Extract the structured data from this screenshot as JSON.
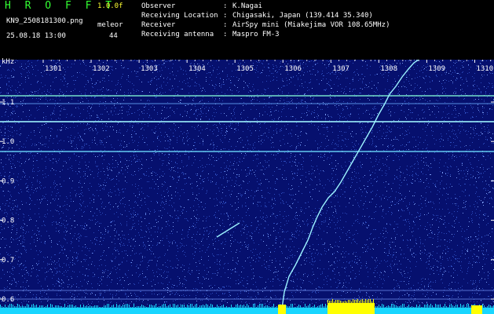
{
  "header": {
    "title": "H R O F F T",
    "version": "1.0.0f",
    "filename": "KN9_2508181300.png",
    "observer_name": "meleor",
    "datetime": "25.08.18 13:00",
    "count": "44",
    "fields": [
      {
        "label": "Observer",
        "value": "K.Nagai"
      },
      {
        "label": "Receiving Location",
        "value": "Chigasaki, Japan (139.414 35.340)"
      },
      {
        "label": "Receiver",
        "value": "AirSpy mini (Miakejima VOR 108.65MHz)"
      },
      {
        "label": "Receiving antenna",
        "value": "Maspro FM-3"
      }
    ]
  },
  "spectrogram": {
    "y_unit": "kHz",
    "x_ticks": [
      "1301",
      "1302",
      "1303",
      "1304",
      "1305",
      "1306",
      "1307",
      "1308",
      "1309",
      "1310"
    ],
    "y_ticks": [
      "1.1",
      "1.0",
      "0.9",
      "0.8",
      "0.7",
      "0.6"
    ],
    "background_color": "#06106e",
    "noise_color": "#3a5fd8",
    "trace_color": "#9bf2ff",
    "floor_color": "#19d6ff",
    "burst_color": "#ffff00"
  }
}
